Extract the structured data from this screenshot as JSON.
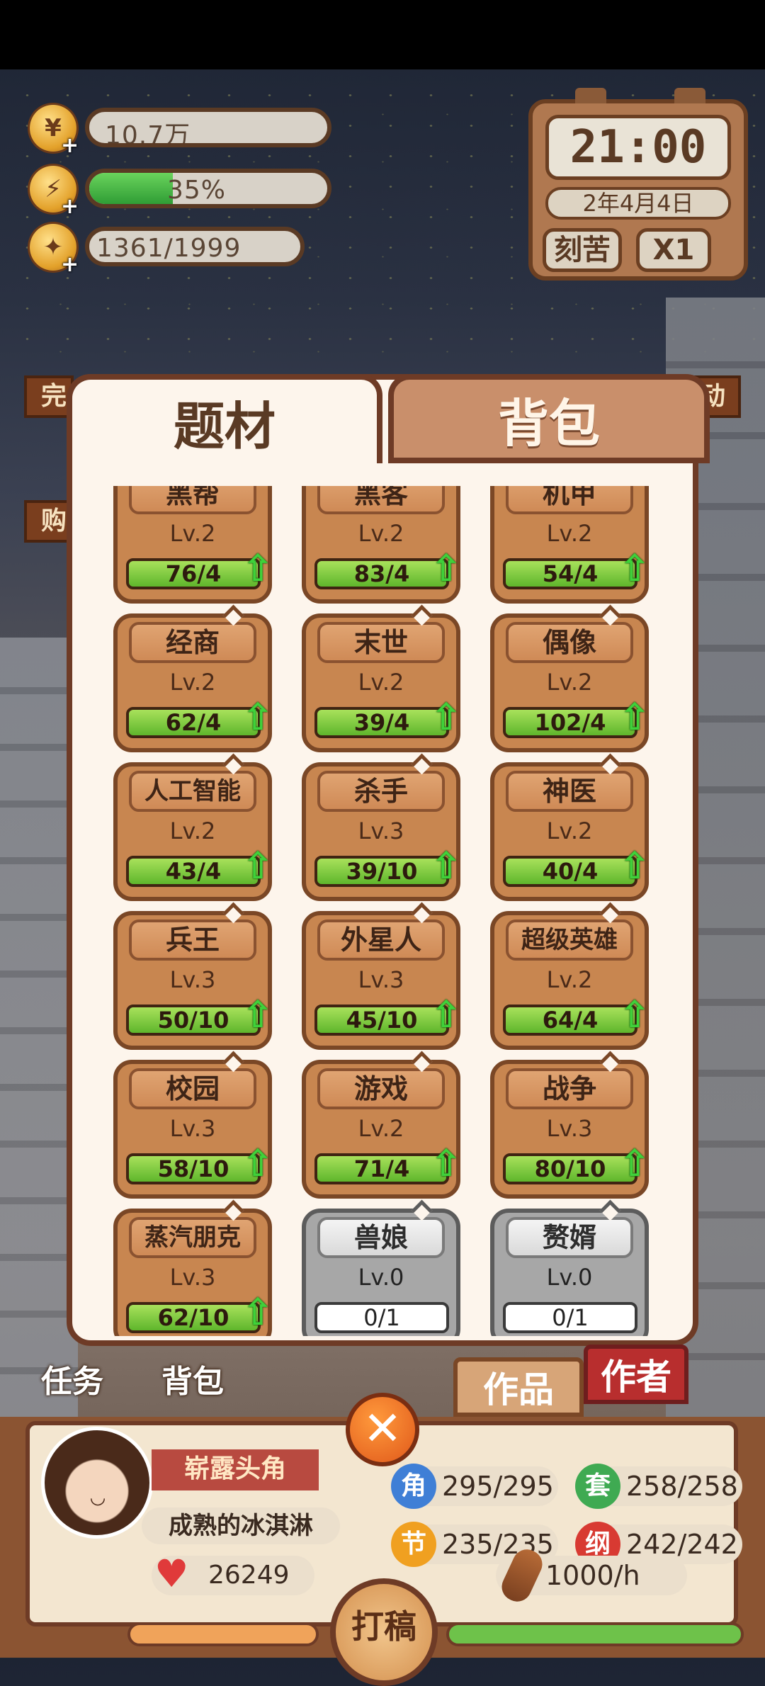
{
  "resources": {
    "coins": "10.7万",
    "energy": "35%",
    "energy_level": 0.35,
    "inspiration": "1361/1999",
    "coin_icon": "coin-icon",
    "energy_icon": "lightning-icon",
    "idea_icon": "lightbulb-icon",
    "plus": "+"
  },
  "clock": {
    "time": "21:00",
    "date": "2年4月4日",
    "mode": "刻苦",
    "speed": "X1"
  },
  "side": {
    "left_top": "完",
    "left_mid": "购",
    "right_top": "动"
  },
  "modal": {
    "tab_active": "题材",
    "tab_inactive": "背包",
    "cards": [
      {
        "name": "黑帮",
        "lv": "Lv.2",
        "progress": "76/4",
        "locked": false
      },
      {
        "name": "黑客",
        "lv": "Lv.2",
        "progress": "83/4",
        "locked": false
      },
      {
        "name": "机甲",
        "lv": "Lv.2",
        "progress": "54/4",
        "locked": false
      },
      {
        "name": "经商",
        "lv": "Lv.2",
        "progress": "62/4",
        "locked": false
      },
      {
        "name": "末世",
        "lv": "Lv.2",
        "progress": "39/4",
        "locked": false
      },
      {
        "name": "偶像",
        "lv": "Lv.2",
        "progress": "102/4",
        "locked": false
      },
      {
        "name": "人工智能",
        "lv": "Lv.2",
        "progress": "43/4",
        "locked": false
      },
      {
        "name": "杀手",
        "lv": "Lv.3",
        "progress": "39/10",
        "locked": false
      },
      {
        "name": "神医",
        "lv": "Lv.2",
        "progress": "40/4",
        "locked": false
      },
      {
        "name": "兵王",
        "lv": "Lv.3",
        "progress": "50/10",
        "locked": false
      },
      {
        "name": "外星人",
        "lv": "Lv.3",
        "progress": "45/10",
        "locked": false
      },
      {
        "name": "超级英雄",
        "lv": "Lv.2",
        "progress": "64/4",
        "locked": false
      },
      {
        "name": "校园",
        "lv": "Lv.3",
        "progress": "58/10",
        "locked": false
      },
      {
        "name": "游戏",
        "lv": "Lv.2",
        "progress": "71/4",
        "locked": false
      },
      {
        "name": "战争",
        "lv": "Lv.3",
        "progress": "80/10",
        "locked": false
      },
      {
        "name": "蒸汽朋克",
        "lv": "Lv.3",
        "progress": "62/10",
        "locked": false
      },
      {
        "name": "兽娘",
        "lv": "Lv.0",
        "progress": "0/1",
        "locked": true
      },
      {
        "name": "赘婿",
        "lv": "Lv.0",
        "progress": "0/1",
        "locked": true
      }
    ],
    "upgrade_icon": "up-arrow-icon"
  },
  "nav": {
    "tasks": "任务",
    "bag": "背包",
    "works": "作品",
    "author": "作者"
  },
  "close_symbol": "✕",
  "player": {
    "title": "崭露头角",
    "name": "成熟的冰淇淋",
    "likes": "26249",
    "stats": [
      {
        "badge": "角",
        "value": "295/295",
        "color": "#3f7fd6"
      },
      {
        "badge": "套",
        "value": "258/258",
        "color": "#3faa52"
      },
      {
        "badge": "节",
        "value": "235/235",
        "color": "#f0a020"
      },
      {
        "badge": "纲",
        "value": "242/242",
        "color": "#d83a32"
      }
    ],
    "rate": "1000/h",
    "draft_button": "打稿"
  }
}
